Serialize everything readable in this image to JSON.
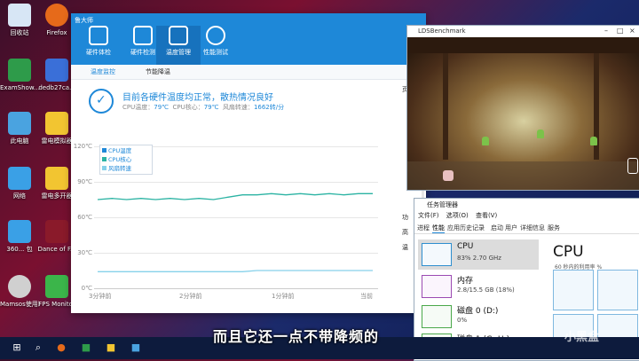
{
  "desktop": {
    "icons": [
      {
        "label": "回收站",
        "color": "#d7e6f5"
      },
      {
        "label": "Firefox",
        "color": "#e66a1a"
      },
      {
        "label": "ExamShow...",
        "color": "#2e9b4a"
      },
      {
        "label": "dedb27ca...",
        "color": "#3a6fd8"
      },
      {
        "label": "此电脑",
        "color": "#4aa3e0"
      },
      {
        "label": "雷电模拟器",
        "color": "#f2c531"
      },
      {
        "label": "网络",
        "color": "#3aa0e6"
      },
      {
        "label": "雷电多开器",
        "color": "#f2c531"
      },
      {
        "label": "360... 包",
        "color": "#3aa0e6"
      },
      {
        "label": "Dance of F...",
        "color": "#8a1a2a"
      },
      {
        "label": "Mamsos使用助手软件",
        "color": "#d0d0d0"
      },
      {
        "label": "FPS Monitor",
        "color": "#3bb54a"
      }
    ]
  },
  "lu": {
    "brand": "鲁大师",
    "tools": [
      "硬件体检",
      "硬件检测",
      "温度管理",
      "性能测试"
    ],
    "active_tool": "温度管理",
    "tabs": [
      "温度监控",
      "节能降温"
    ],
    "headline": "目前各硬件温度均正常，散热情况良好",
    "cpu_temp_label": "CPU温度：",
    "cpu_temp": "79℃",
    "cpu_core_label": "CPU核心：",
    "cpu_core": "79℃",
    "fan_label": "风扇转速：",
    "fan": "1662转/分",
    "partial_right": [
      "页",
      "功",
      "高",
      "温"
    ]
  },
  "chart_data": {
    "type": "line",
    "ylim": [
      0,
      120
    ],
    "y_ticks": [
      "120℃",
      "90℃",
      "60℃",
      "30℃",
      "0℃"
    ],
    "x_ticks": [
      "3分钟前",
      "2分钟前",
      "1分钟前",
      "当前"
    ],
    "legend": [
      "CPU温度",
      "CPU核心",
      "风扇转速"
    ],
    "series": [
      {
        "name": "CPU温度",
        "color": "#2bb3a3",
        "values": [
          75,
          76,
          75,
          76,
          75,
          76,
          75,
          76,
          75,
          77,
          79,
          79,
          80,
          79,
          80,
          79,
          80,
          79,
          80,
          80
        ]
      },
      {
        "name": "风扇转速",
        "color": "#86d1ea",
        "values": [
          14,
          14,
          14,
          14,
          14,
          14,
          14,
          14,
          14,
          14,
          14,
          15,
          15,
          15,
          15,
          15,
          15,
          15,
          15,
          15
        ]
      }
    ]
  },
  "lds": {
    "title": "LDSBenchmark"
  },
  "taskmgr": {
    "title": "任务管理器",
    "menu": [
      "文件(F)",
      "选项(O)",
      "查看(V)"
    ],
    "tabs": [
      "进程",
      "性能",
      "应用历史记录",
      "启动",
      "用户",
      "详细信息",
      "服务"
    ],
    "active_tab": "性能",
    "resources": [
      {
        "name": "CPU",
        "value": "83%  2.70 GHz"
      },
      {
        "name": "内存",
        "value": "2.8/15.5 GB (18%)"
      },
      {
        "name": "磁盘 0 (D:)",
        "value": "0%"
      },
      {
        "name": "磁盘 1 (G: H:)",
        "value": "2%"
      }
    ],
    "cpu_header": "CPU",
    "cpu_note": "60 秒内的利用率 %"
  },
  "subtitle": "而且它还一点不带降频的",
  "watermark": "小黑盒"
}
